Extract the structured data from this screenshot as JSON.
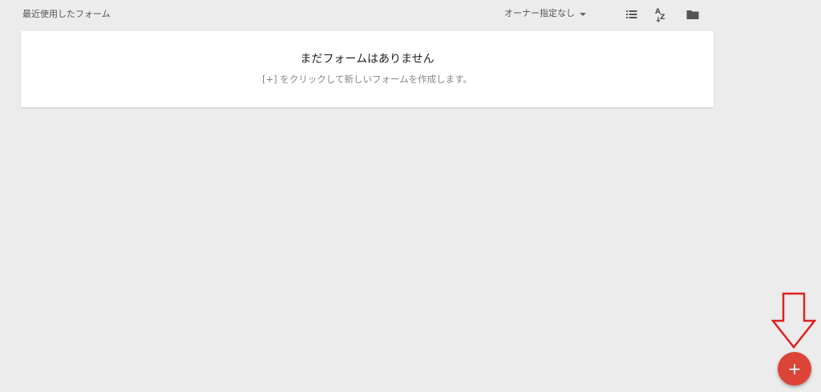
{
  "header": {
    "section_title": "最近使用したフォーム",
    "owner_filter_label": "オーナー指定なし",
    "icons": [
      "list-view-icon",
      "sort-az-icon",
      "folder-icon"
    ]
  },
  "empty_state": {
    "title": "まだフォームはありません",
    "subtitle": "[+] をクリックして新しいフォームを作成します。"
  },
  "fab": {
    "label": "+",
    "color": "#db4437"
  },
  "annotation": {
    "arrow_color": "#e02020"
  },
  "colors": {
    "background": "#ececec",
    "card": "#ffffff"
  }
}
